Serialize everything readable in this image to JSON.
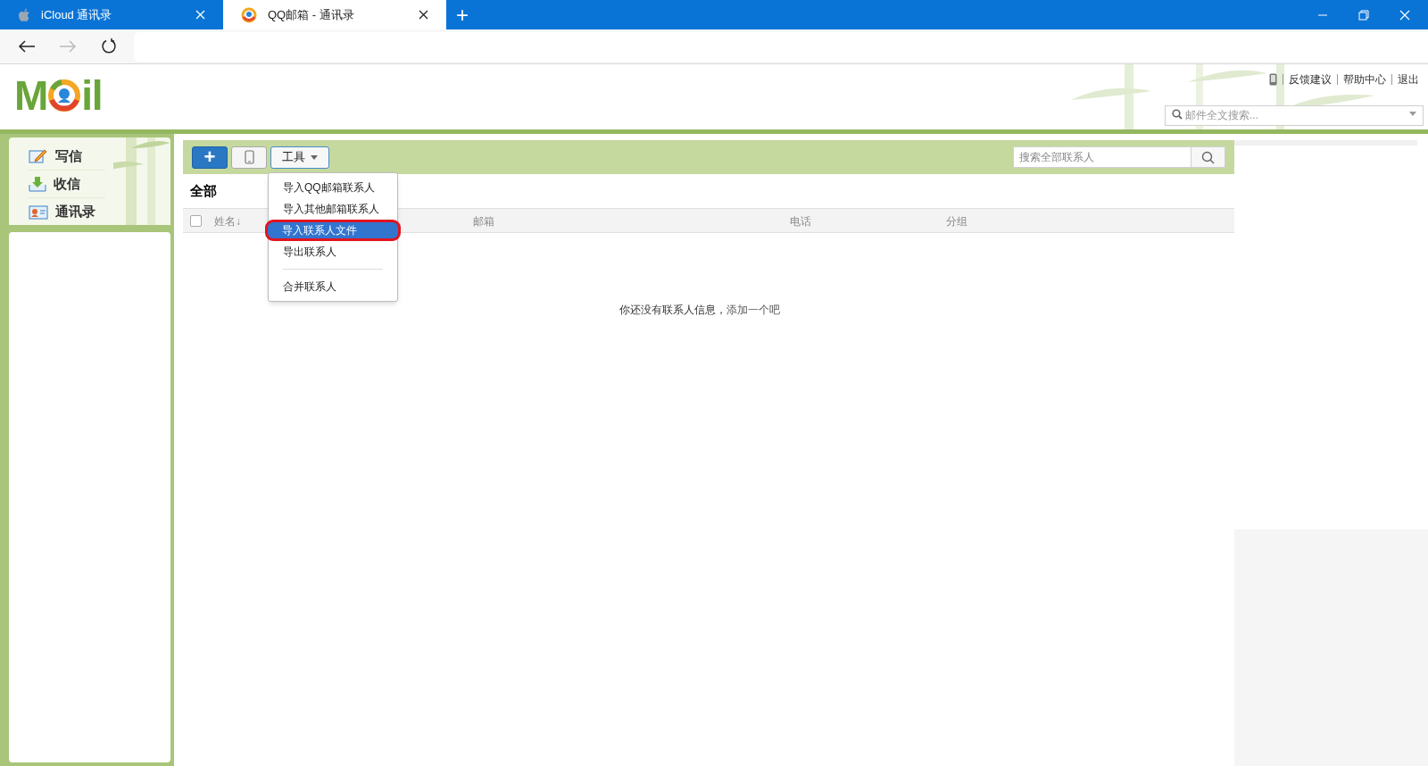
{
  "browser_tabs": [
    {
      "title": "iCloud 通讯录",
      "selected": false
    },
    {
      "title": "QQ邮箱 - 通讯录",
      "selected": true
    }
  ],
  "new_tab": "+",
  "logo": {
    "before": "M",
    "after": "il"
  },
  "top_links": [
    "反馈建议",
    "帮助中心",
    "退出"
  ],
  "mail_search": {
    "placeholder": "邮件全文搜索..."
  },
  "sidebar": {
    "items": [
      {
        "label": "写信"
      },
      {
        "label": "收信"
      },
      {
        "label": "通讯录"
      }
    ]
  },
  "toolbar": {
    "add": "+",
    "tools": "工具",
    "search": {
      "placeholder": "搜索全部联系人"
    }
  },
  "group_title": "全部",
  "table": {
    "select_all": {
      "checked": false
    },
    "columns": [
      "姓名↓",
      "邮箱",
      "电话",
      "分组"
    ]
  },
  "empty": {
    "text": "你还没有联系人信息，",
    "link": "添加一个吧"
  },
  "tools_menu": [
    {
      "label": "导入QQ邮箱联系人",
      "selected": false,
      "divider_before": false
    },
    {
      "label": "导入其他邮箱联系人",
      "selected": false,
      "divider_before": false
    },
    {
      "label": "导入联系人文件",
      "selected": true,
      "divider_before": false
    },
    {
      "label": "导出联系人",
      "selected": false,
      "divider_before": false
    },
    {
      "label": "合并联系人",
      "selected": false,
      "divider_before": true
    }
  ]
}
